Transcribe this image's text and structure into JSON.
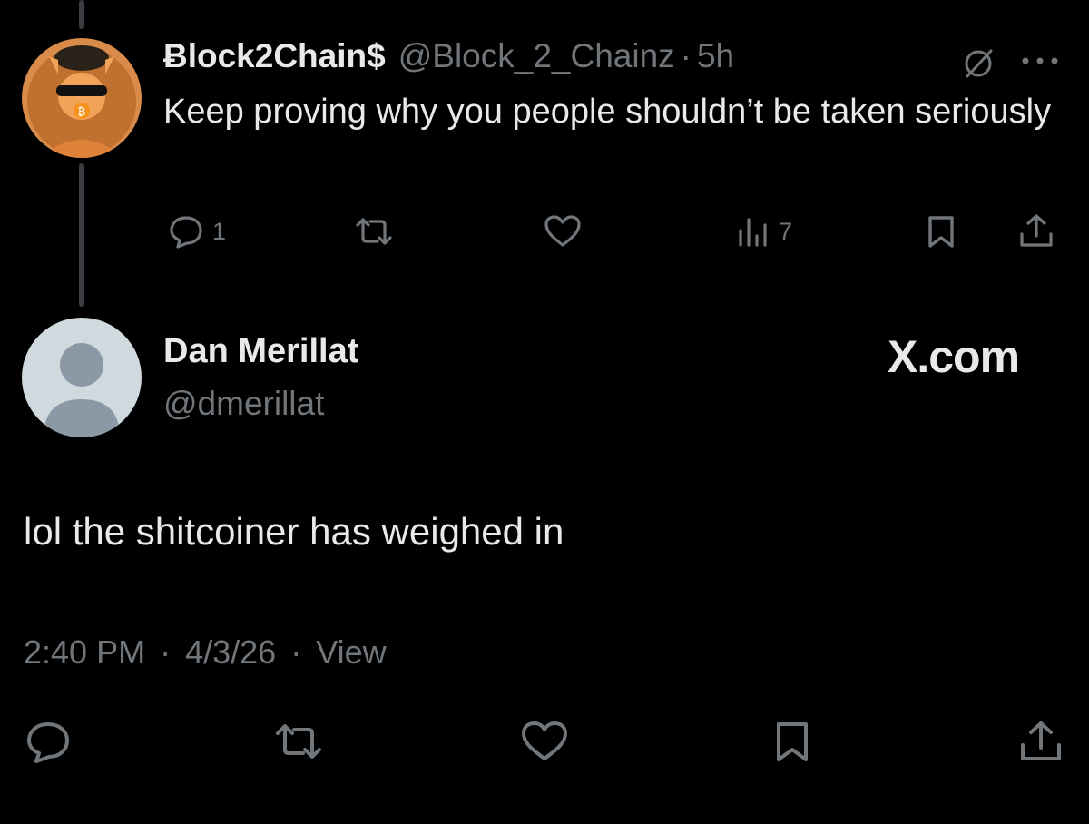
{
  "colors": {
    "background": "#000000",
    "text_primary": "#e7e9ea",
    "text_secondary": "#71767b",
    "thread_line": "#3a3d41"
  },
  "parent_tweet": {
    "display_name": "Ƀlock2Chain$",
    "handle": "@Block_2_Chainz",
    "separator": "·",
    "time": "5h",
    "text": "Keep proving why you people shouldn’t be taken seriously",
    "grok_icon": "grok-icon",
    "more_icon": "more-dots-icon",
    "actions": {
      "reply_count": "1",
      "retweet_count": "",
      "like_count": "",
      "views_count": "7"
    }
  },
  "reply_tweet": {
    "display_name": "Dan Merillat",
    "handle": "@dmerillat",
    "brand": "X.com",
    "text": "lol the shitcoiner has weighed in",
    "time": "2:40 PM",
    "date": "4/3/26",
    "separator": "·",
    "view_label": "View"
  }
}
